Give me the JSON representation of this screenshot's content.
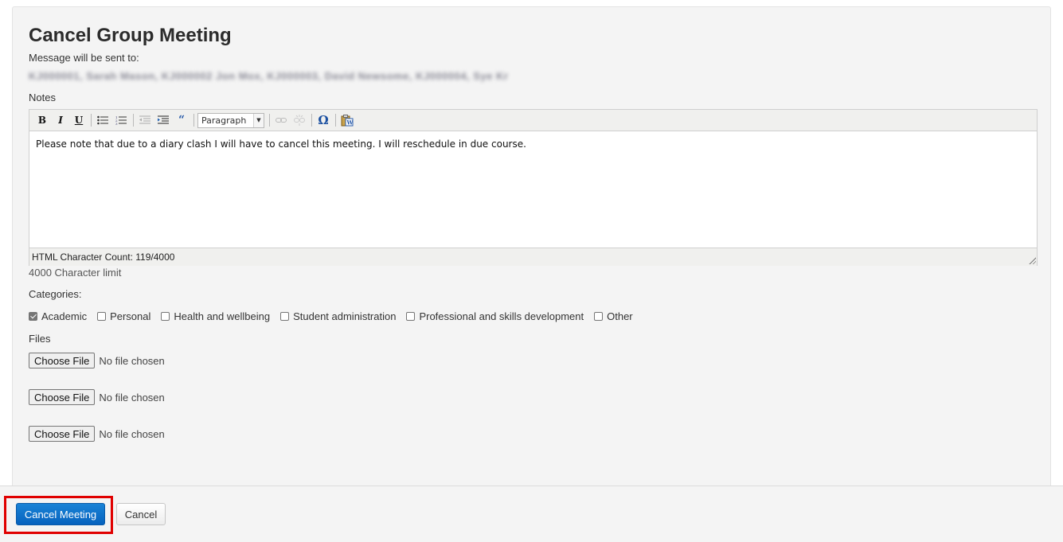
{
  "dialog": {
    "title": "Cancel Group Meeting",
    "sent_to_label": "Message will be sent to:",
    "recipients_redacted": "KJ000001, Sarah Mason, KJ000002 Jon Mox, KJ000003, David Newsome, KJ000004, Sye Kr"
  },
  "notes": {
    "label": "Notes",
    "toolbar": {
      "bold": "B",
      "italic": "I",
      "underline": "U",
      "format_select": "Paragraph",
      "special_char": "Ω"
    },
    "body": "Please note that due to a diary clash I will have to cancel this meeting. I will reschedule in due course.",
    "char_count": "HTML Character Count: 119/4000",
    "limit_text": "4000 Character limit"
  },
  "categories": {
    "label": "Categories:",
    "items": [
      {
        "label": "Academic",
        "checked": true
      },
      {
        "label": "Personal",
        "checked": false
      },
      {
        "label": "Health and wellbeing",
        "checked": false
      },
      {
        "label": "Student administration",
        "checked": false
      },
      {
        "label": "Professional and skills development",
        "checked": false
      },
      {
        "label": "Other",
        "checked": false
      }
    ]
  },
  "files": {
    "label": "Files",
    "inputs": [
      {
        "button": "Choose File",
        "status": "No file chosen"
      },
      {
        "button": "Choose File",
        "status": "No file chosen"
      },
      {
        "button": "Choose File",
        "status": "No file chosen"
      }
    ]
  },
  "footer": {
    "primary_label": "Cancel Meeting",
    "secondary_label": "Cancel",
    "primary_color": "#0a6fcc",
    "highlight_color": "#e00000"
  }
}
